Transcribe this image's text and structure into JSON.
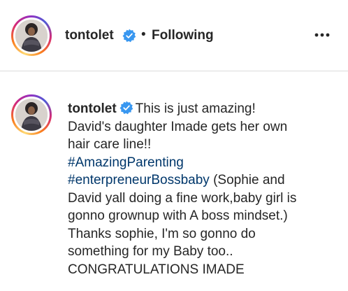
{
  "header": {
    "username": "tontolet",
    "separator": "•",
    "follow_status": "Following",
    "more_icon": "more-horizontal-icon",
    "verified_icon": "verified-badge-icon"
  },
  "caption": {
    "username": "tontolet",
    "line1": "This is just amazing!",
    "line2": "David's daughter Imade gets her own",
    "line3": "hair care line!!",
    "hashtag1": "#AmazingParenting",
    "hashtag2": "#enterpreneurBossbaby",
    "line5_rest": " (Sophie and",
    "line6": "David yall doing a fine work,baby girl is",
    "line7": "gonno grownup with A boss mindset.)",
    "line8": "Thanks sophie, I'm so gonno do",
    "line9": "something for my Baby too..",
    "line10": "CONGRATULATIONS IMADE"
  },
  "colors": {
    "text": "#262626",
    "hashtag": "#00376b",
    "verified": "#3897f0",
    "divider": "#dbdbdb"
  }
}
